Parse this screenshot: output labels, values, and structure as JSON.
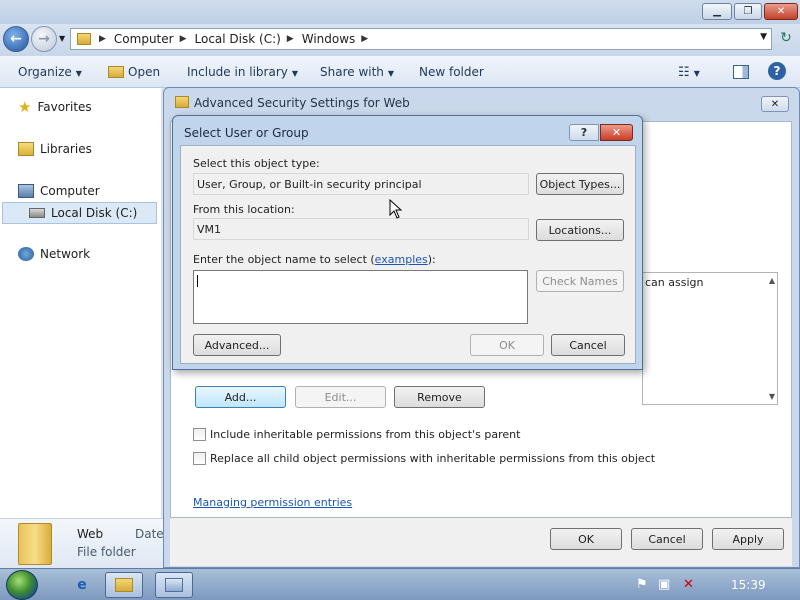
{
  "explorer": {
    "window_buttons": {
      "minimize": "▁",
      "restore": "❐",
      "close": "✕"
    },
    "breadcrumb": [
      "Computer",
      "Local Disk (C:)",
      "Windows"
    ],
    "toolbar": {
      "organize": "Organize",
      "open": "Open",
      "include_in_library": "Include in library",
      "share_with": "Share with",
      "new_folder": "New folder"
    },
    "nav": {
      "favorites": "Favorites",
      "libraries": "Libraries",
      "computer": "Computer",
      "local_disk": "Local Disk (C:)",
      "network": "Network"
    },
    "details": {
      "name": "Web",
      "type": "File folder",
      "date_label": "Date"
    }
  },
  "advanced_security": {
    "title": "Advanced Security Settings for Web",
    "close": "✕",
    "permissions_snippet": "can assign",
    "add_label": "Add...",
    "edit_label": "Edit...",
    "remove_label": "Remove",
    "include_inheritable": "Include inheritable permissions from this object's parent",
    "replace_child": "Replace all child object permissions with inheritable permissions from this object",
    "managing_link": "Managing permission entries",
    "ok": "OK",
    "cancel": "Cancel",
    "apply": "Apply"
  },
  "select_user_dialog": {
    "title": "Select User or Group",
    "help": "?",
    "close": "✕",
    "object_type_label": "Select this object type:",
    "object_type_value": "User, Group, or Built-in security principal",
    "object_types_button": "Object Types...",
    "location_label": "From this location:",
    "location_value": "VM1",
    "locations_button": "Locations...",
    "enter_name_prefix": "Enter the object name to select (",
    "examples_link": "examples",
    "enter_name_suffix": "):",
    "object_name_value": "",
    "check_names_button": "Check Names",
    "advanced_button": "Advanced...",
    "ok": "OK",
    "cancel": "Cancel"
  },
  "taskbar": {
    "clock": "15:39"
  }
}
